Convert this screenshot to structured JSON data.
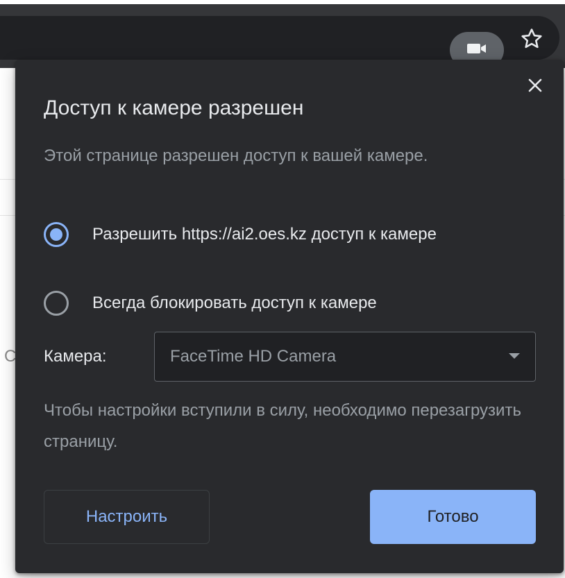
{
  "toolbar": {
    "camera_chip_icon": "video-camera-icon",
    "bookmark_icon": "star-icon"
  },
  "bubble": {
    "close_icon": "close-icon",
    "title": "Доступ к камере разрешен",
    "description": "Этой странице разрешен доступ к вашей камере.",
    "options": [
      {
        "label": "Разрешить https://ai2.oes.kz доступ к камере",
        "checked": true
      },
      {
        "label": "Всегда блокировать доступ к камере",
        "checked": false
      }
    ],
    "camera_label": "Камера:",
    "camera_select": {
      "value": "FaceTime HD Camera"
    },
    "note": "Чтобы настройки вступили в силу, необходимо перезагрузить страницу.",
    "configure_button": "Настроить",
    "done_button": "Готово"
  },
  "page_behind": {
    "partial_letter": "С"
  },
  "colors": {
    "bubble_bg": "#292a2d",
    "accent": "#8ab4f8",
    "text_primary": "#e8eaed",
    "text_secondary": "#9aa0a6"
  }
}
